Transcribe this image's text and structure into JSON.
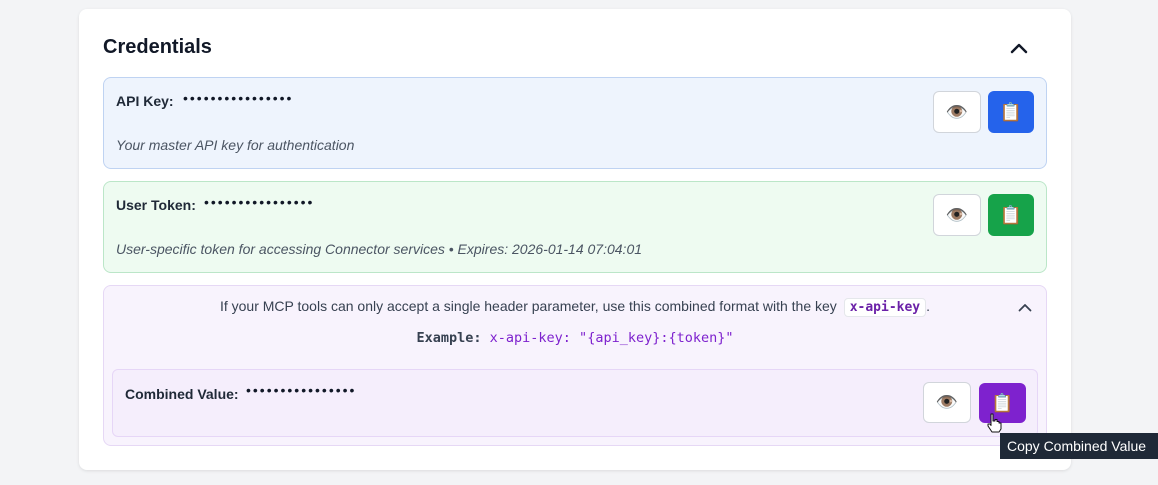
{
  "section": {
    "title": "Credentials",
    "collapse_icon": "chevron-up-icon"
  },
  "api_key": {
    "label": "API Key:",
    "masked_value": "••••••••••••••••",
    "description": "Your master API key for authentication",
    "accent": "#2563eb"
  },
  "user_token": {
    "label": "User Token:",
    "masked_value": "••••••••••••••••",
    "description": "User-specific token for accessing Connector services • Expires: 2026-01-14 07:04:01",
    "accent": "#16a34a"
  },
  "combined": {
    "info_text": "If your MCP tools can only accept a single header parameter, use this combined format with the key",
    "key_name": "x-api-key",
    "info_suffix": ".",
    "example_label": "Example:",
    "example_value": "x-api-key: \"{api_key}:{token}\"",
    "label": "Combined Value:",
    "masked_value": "••••••••••••••••",
    "accent": "#7e22ce"
  },
  "icons": {
    "reveal": "👁️",
    "copy": "📋"
  },
  "tooltip": {
    "text": "Copy Combined Value"
  }
}
